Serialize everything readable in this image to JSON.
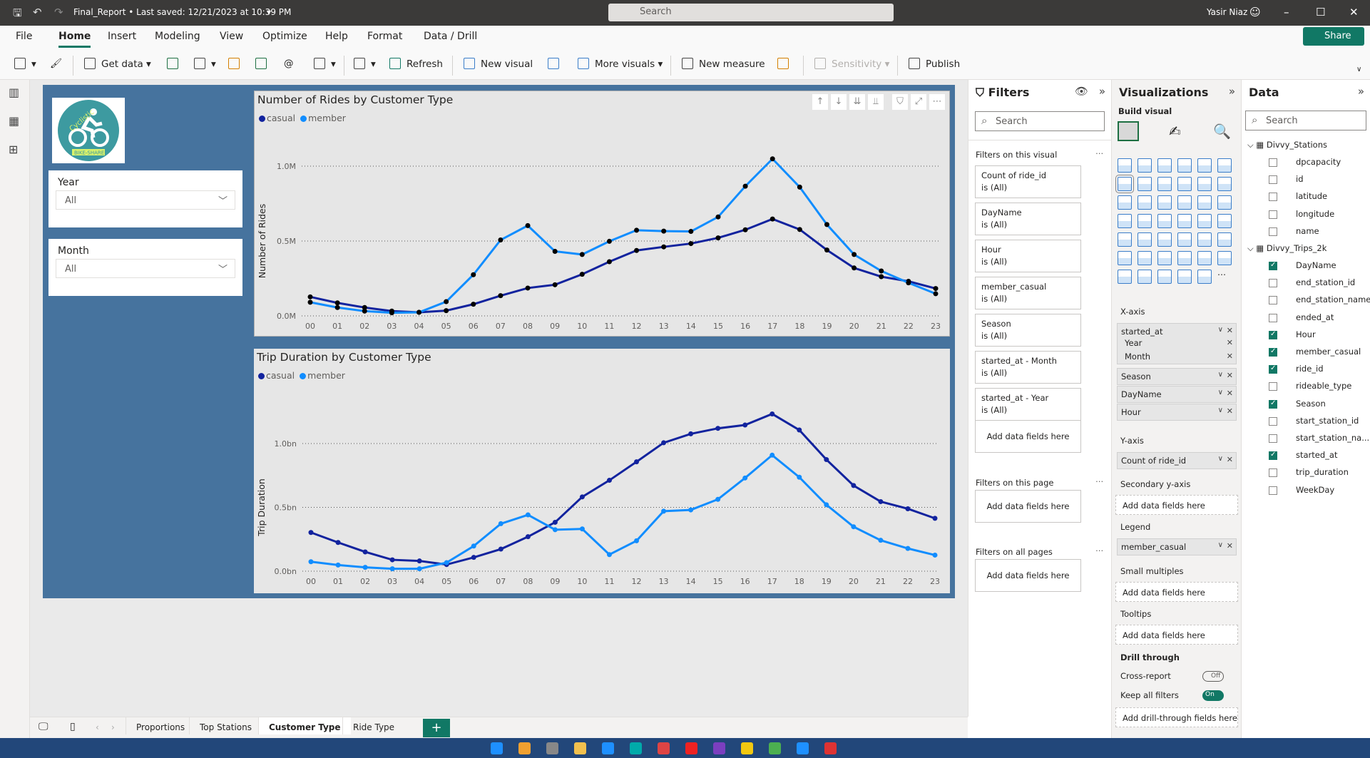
{
  "titlebar": {
    "doc": "Final_Report • Last saved: 12/21/2023 at 10:39 PM",
    "search": "Search",
    "user": "Yasir Niaz"
  },
  "menu": {
    "items": [
      "File",
      "Home",
      "Insert",
      "Modeling",
      "View",
      "Optimize",
      "Help",
      "Format",
      "Data / Drill"
    ],
    "active": "Home",
    "share": "Share"
  },
  "toolbar": {
    "get_data": "Get data",
    "refresh": "Refresh",
    "new_visual": "New visual",
    "more_visuals": "More visuals",
    "new_measure": "New measure",
    "sensitivity": "Sensitivity",
    "publish": "Publish"
  },
  "logo": {
    "text": "Cyclistic",
    "sub": "BIKE-SHARE",
    "color": "#3d9aa0"
  },
  "slicers": [
    {
      "label": "Year",
      "value": "All"
    },
    {
      "label": "Month",
      "value": "All"
    }
  ],
  "colors": {
    "casual": "#12239e",
    "member": "#118dff",
    "accent": "#117865",
    "page": "#46739e"
  },
  "chart_data": [
    {
      "type": "line",
      "title": "Number of Rides by Customer Type",
      "ylabel": "Number of Rides",
      "xlabel": "",
      "categories": [
        "00",
        "01",
        "02",
        "03",
        "04",
        "05",
        "06",
        "07",
        "08",
        "09",
        "10",
        "11",
        "12",
        "13",
        "14",
        "15",
        "16",
        "17",
        "18",
        "19",
        "20",
        "21",
        "22",
        "23"
      ],
      "yticks": [
        "0.0M",
        "0.5M",
        "1.0M"
      ],
      "ylim": [
        0,
        1.0
      ],
      "yunit": "M",
      "grid": true,
      "legend": "top-left",
      "series": [
        {
          "name": "casual",
          "values": [
            0.127,
            0.087,
            0.056,
            0.032,
            0.024,
            0.035,
            0.078,
            0.135,
            0.186,
            0.208,
            0.278,
            0.362,
            0.437,
            0.461,
            0.483,
            0.521,
            0.575,
            0.647,
            0.577,
            0.44,
            0.32,
            0.262,
            0.231,
            0.183
          ]
        },
        {
          "name": "member",
          "values": [
            0.091,
            0.056,
            0.032,
            0.021,
            0.024,
            0.095,
            0.275,
            0.507,
            0.603,
            0.431,
            0.41,
            0.498,
            0.572,
            0.566,
            0.564,
            0.661,
            0.866,
            1.049,
            0.86,
            0.61,
            0.41,
            0.3,
            0.221,
            0.148
          ]
        }
      ]
    },
    {
      "type": "line",
      "title": "Trip Duration by Customer Type",
      "ylabel": "Trip Duration",
      "xlabel": "",
      "categories": [
        "00",
        "01",
        "02",
        "03",
        "04",
        "05",
        "06",
        "07",
        "08",
        "09",
        "10",
        "11",
        "12",
        "13",
        "14",
        "15",
        "16",
        "17",
        "18",
        "19",
        "20",
        "21",
        "22",
        "23"
      ],
      "yticks": [
        "0.0bn",
        "0.5bn",
        "1.0bn"
      ],
      "ylim": [
        0,
        1.0
      ],
      "yunit": "bn",
      "grid": true,
      "legend": "top-left",
      "series": [
        {
          "name": "casual",
          "values": [
            0.303,
            0.225,
            0.151,
            0.089,
            0.08,
            0.052,
            0.108,
            0.173,
            0.27,
            0.383,
            0.582,
            0.712,
            0.857,
            1.006,
            1.076,
            1.119,
            1.145,
            1.232,
            1.106,
            0.874,
            0.671,
            0.545,
            0.489,
            0.414
          ]
        },
        {
          "name": "member",
          "values": [
            0.074,
            0.048,
            0.03,
            0.019,
            0.019,
            0.067,
            0.197,
            0.372,
            0.441,
            0.325,
            0.331,
            0.13,
            0.238,
            0.47,
            0.48,
            0.563,
            0.73,
            0.909,
            0.736,
            0.52,
            0.348,
            0.242,
            0.178,
            0.126
          ]
        }
      ]
    }
  ],
  "filters": {
    "title": "Filters",
    "search": "Search",
    "on_visual": "Filters on this visual",
    "cards": [
      {
        "field": "Count of ride_id",
        "state": "is (All)"
      },
      {
        "field": "DayName",
        "state": "is (All)"
      },
      {
        "field": "Hour",
        "state": "is (All)"
      },
      {
        "field": "member_casual",
        "state": "is (All)"
      },
      {
        "field": "Season",
        "state": "is (All)"
      },
      {
        "field": "started_at - Month",
        "state": "is (All)"
      },
      {
        "field": "started_at - Year",
        "state": "is (All)"
      }
    ],
    "add": "Add data fields here",
    "on_page": "Filters on this page",
    "on_all": "Filters on all pages"
  },
  "viz": {
    "title": "Visualizations",
    "build": "Build visual",
    "xaxis": "X-axis",
    "x_field": "started_at",
    "x_sub": [
      "Year",
      "Month"
    ],
    "x_wells": [
      "Season",
      "DayName",
      "Hour"
    ],
    "yaxis": "Y-axis",
    "y_field": "Count of ride_id",
    "secondary": "Secondary y-axis",
    "legend": "Legend",
    "legend_field": "member_casual",
    "small": "Small multiples",
    "tooltips": "Tooltips",
    "add": "Add data fields here",
    "drill": "Drill through",
    "cross": "Cross-report",
    "cross_state": "Off",
    "keep": "Keep all filters",
    "keep_state": "On",
    "drill_add": "Add drill-through fields here"
  },
  "data": {
    "title": "Data",
    "search": "Search",
    "tables": [
      {
        "name": "Divvy_Stations",
        "fields": [
          {
            "n": "dpcapacity",
            "c": false
          },
          {
            "n": "id",
            "c": false
          },
          {
            "n": "latitude",
            "c": false
          },
          {
            "n": "longitude",
            "c": false
          },
          {
            "n": "name",
            "c": false
          }
        ]
      },
      {
        "name": "Divvy_Trips_2k",
        "fields": [
          {
            "n": "DayName",
            "c": true
          },
          {
            "n": "end_station_id",
            "c": false
          },
          {
            "n": "end_station_name",
            "c": false
          },
          {
            "n": "ended_at",
            "c": false
          },
          {
            "n": "Hour",
            "c": true
          },
          {
            "n": "member_casual",
            "c": true
          },
          {
            "n": "ride_id",
            "c": true
          },
          {
            "n": "rideable_type",
            "c": false
          },
          {
            "n": "Season",
            "c": true
          },
          {
            "n": "start_station_id",
            "c": false
          },
          {
            "n": "start_station_na...",
            "c": false
          },
          {
            "n": "started_at",
            "c": true
          },
          {
            "n": "trip_duration",
            "c": false
          },
          {
            "n": "WeekDay",
            "c": false
          }
        ]
      }
    ]
  },
  "tabs": {
    "items": [
      "Proportions",
      "Top Stations",
      "Customer Type",
      "Ride Type"
    ],
    "active": "Customer Type",
    "add": "+"
  }
}
